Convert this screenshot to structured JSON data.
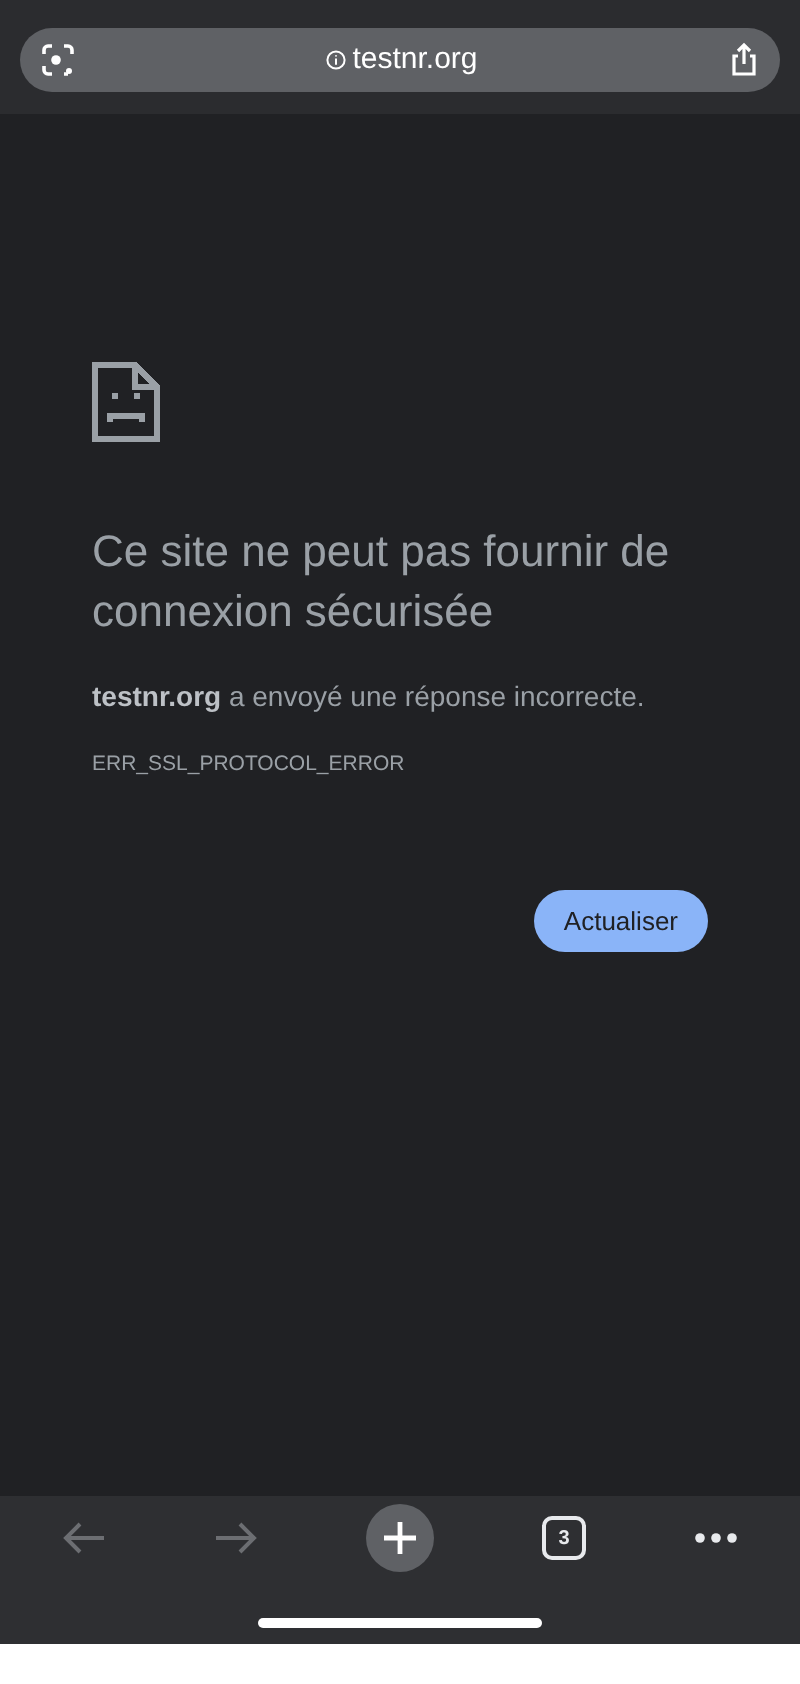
{
  "address_bar": {
    "url": "testnr.org"
  },
  "error": {
    "title": "Ce site ne peut pas fournir de connexion sécurisée",
    "message": "**testnr.org** a envoyé une réponse incorrecte.",
    "code": "ERR_SSL_PROTOCOL_ERROR",
    "button": "Actualiser"
  },
  "toolbar": {
    "back_disabled": true,
    "forward_disabled": true,
    "tab_count": "3"
  }
}
